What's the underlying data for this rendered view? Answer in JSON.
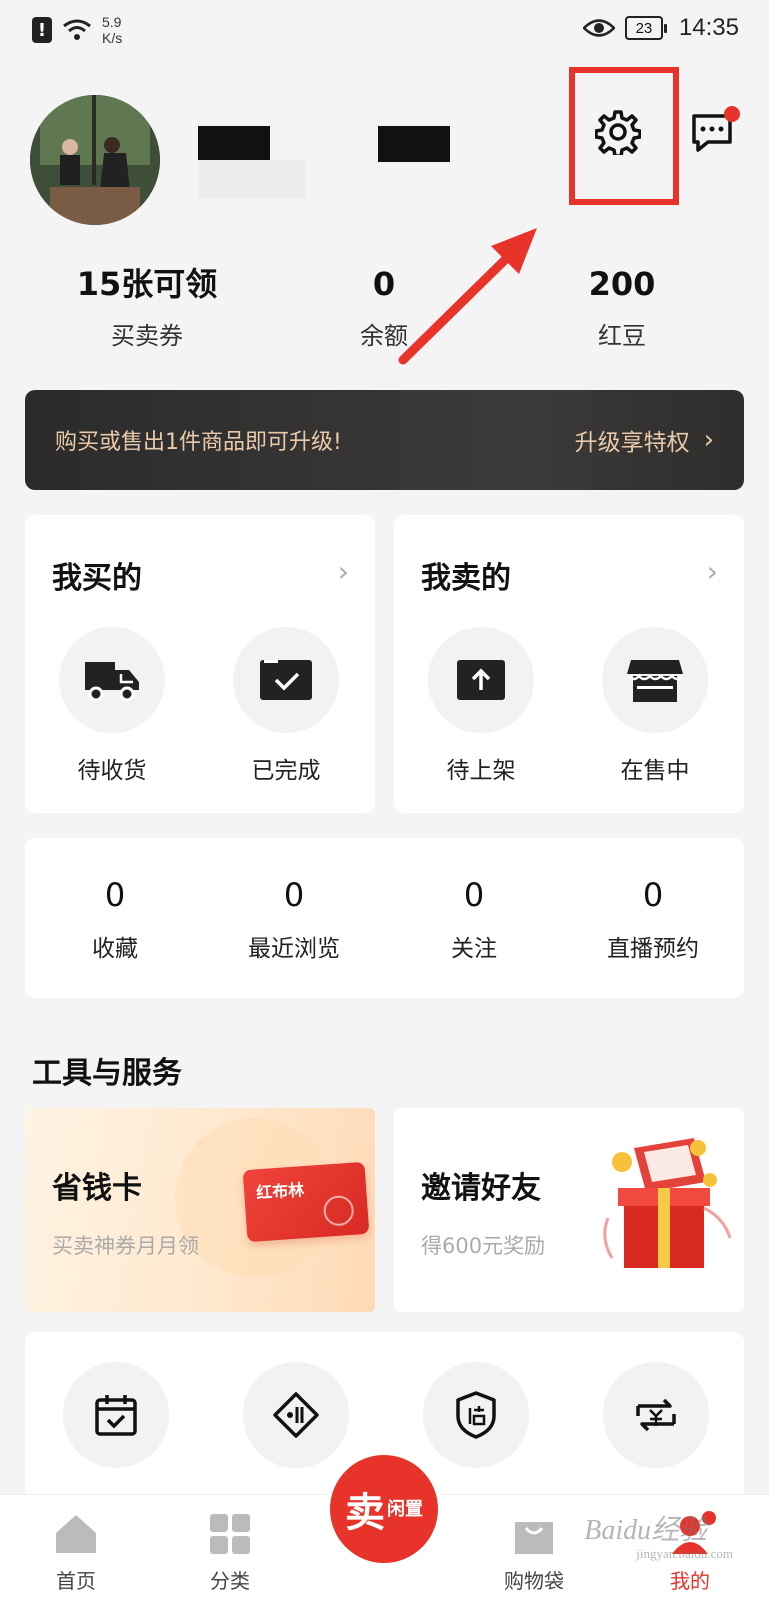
{
  "status_bar": {
    "net_speed_value": "5.9",
    "net_speed_unit": "K/s",
    "battery": "23",
    "time": "14:35"
  },
  "stats": [
    {
      "value": "15张可领",
      "label": "买卖券"
    },
    {
      "value": "0",
      "label": "余额"
    },
    {
      "value": "200",
      "label": "红豆"
    }
  ],
  "banner": {
    "text": "购买或售出1件商品即可升级!",
    "cta": "升级享特权"
  },
  "buy_card": {
    "title": "我买的",
    "items": [
      {
        "label": "待收货",
        "icon": "truck-icon"
      },
      {
        "label": "已完成",
        "icon": "check-box-icon"
      }
    ]
  },
  "sell_card": {
    "title": "我卖的",
    "items": [
      {
        "label": "待上架",
        "icon": "upload-icon"
      },
      {
        "label": "在售中",
        "icon": "store-icon"
      }
    ]
  },
  "counts": [
    {
      "value": "0",
      "label": "收藏"
    },
    {
      "value": "0",
      "label": "最近浏览"
    },
    {
      "value": "0",
      "label": "关注"
    },
    {
      "value": "0",
      "label": "直播预约"
    }
  ],
  "tools": {
    "title": "工具与服务",
    "save_card": {
      "title": "省钱卡",
      "subtitle": "买卖神券月月领",
      "badge": "红布林"
    },
    "invite_card": {
      "title": "邀请好友",
      "subtitle": "得600元奖励"
    }
  },
  "tabbar": {
    "items": [
      {
        "label": "首页"
      },
      {
        "label": "分类"
      },
      {
        "label": "购物袋"
      },
      {
        "label": "我的"
      }
    ],
    "sell_main": "卖",
    "sell_sub": "闲置"
  },
  "watermark": {
    "text": "Baidu经验",
    "sub": "jingyan.baidu.com"
  },
  "colors": {
    "accent": "#e8332a",
    "banner_text": "#e9c9a8"
  }
}
